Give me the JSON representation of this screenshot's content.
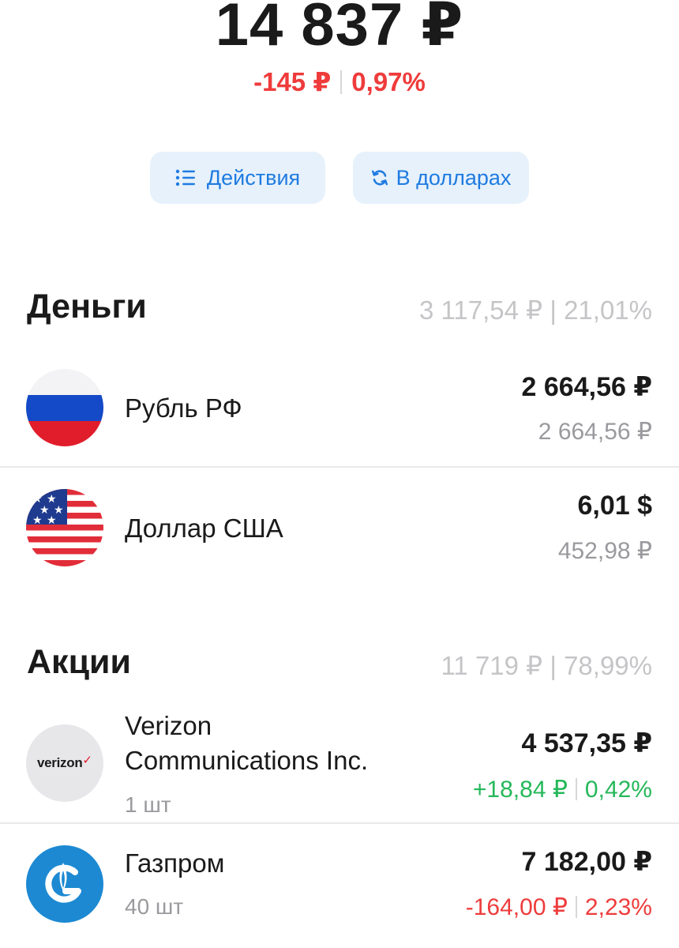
{
  "header": {
    "total": "14 837 ₽",
    "change_amount": "-145 ₽",
    "change_percent": "0,97%"
  },
  "actions": {
    "actions_label": "Действия",
    "actions_icon": "list-icon",
    "currency_label": "В долларах",
    "currency_icon": "refresh-icon"
  },
  "money": {
    "title": "Деньги",
    "summary": "3 117,54 ₽ | 21,01%",
    "items": [
      {
        "name": "Рубль РФ",
        "icon": "russia-flag-icon",
        "amount": "2 664,56 ₽",
        "secondary": "2 664,56 ₽"
      },
      {
        "name": "Доллар США",
        "icon": "usa-flag-icon",
        "amount": "6,01 $",
        "secondary": "452,98 ₽"
      }
    ]
  },
  "stocks": {
    "title": "Акции",
    "summary": "11 719 ₽ | 78,99%",
    "items": [
      {
        "name_line1": "Verizon",
        "name_line2": "Communications Inc.",
        "logo_text": "verizon",
        "logo_mark": "✓",
        "quantity": "1 шт",
        "amount": "4 537,35 ₽",
        "change_amount": "+18,84 ₽",
        "change_percent": "0,42%",
        "change_color": "#25b85a"
      },
      {
        "name": "Газпром",
        "logo": "gazprom-logo-icon",
        "quantity": "40 шт",
        "amount": "7 182,00 ₽",
        "change_amount": "-164,00 ₽",
        "change_percent": "2,23%",
        "change_color": "#ee3c3c"
      }
    ]
  },
  "colors": {
    "accent": "#1f7be0",
    "accent_bg": "#e6f1fc",
    "negative": "#ef3b3b",
    "positive": "#25b85a"
  }
}
